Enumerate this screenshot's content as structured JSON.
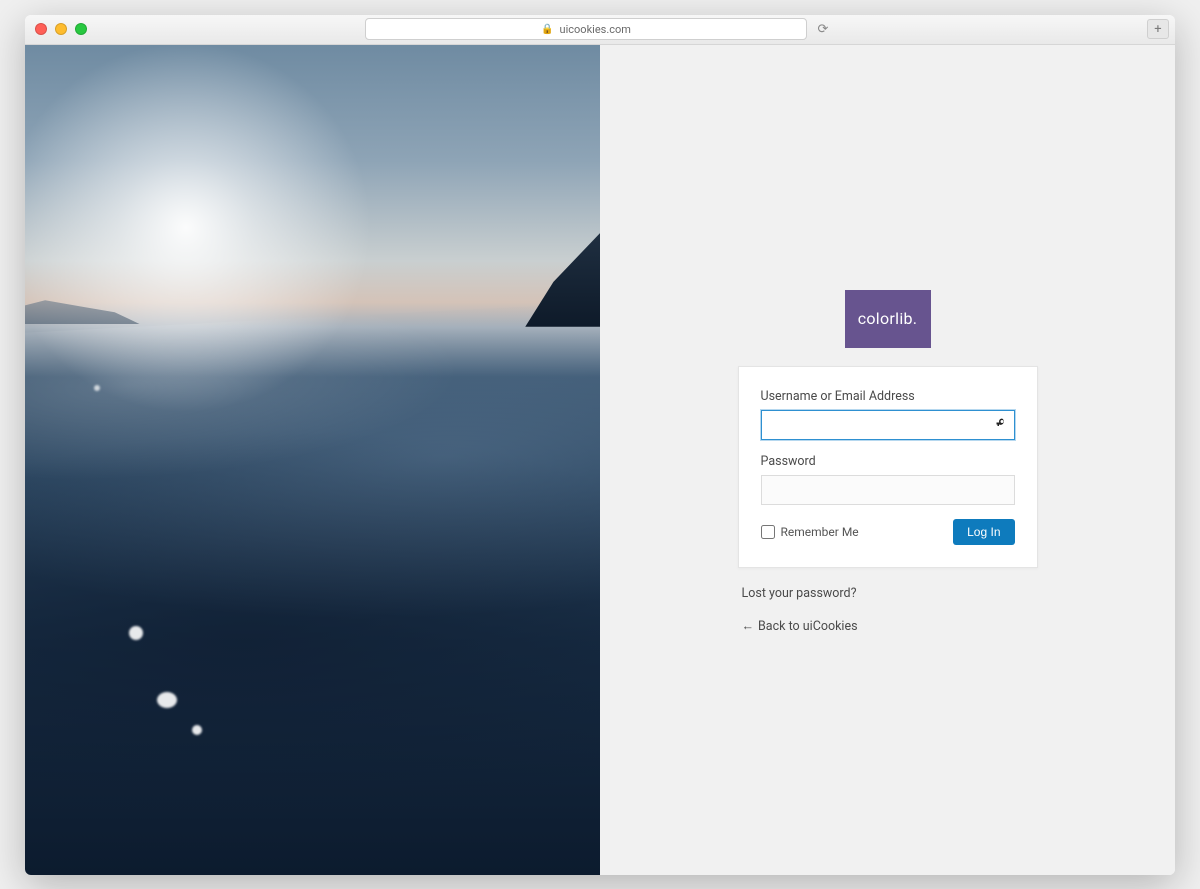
{
  "browser": {
    "url_display": "uicookies.com"
  },
  "logo": {
    "text": "colorlib."
  },
  "form": {
    "username_label": "Username or Email Address",
    "username_value": "",
    "password_label": "Password",
    "password_value": "",
    "remember_label": "Remember Me",
    "submit_label": "Log In"
  },
  "links": {
    "lost_password": "Lost your password?",
    "back": "Back to uiCookies"
  }
}
